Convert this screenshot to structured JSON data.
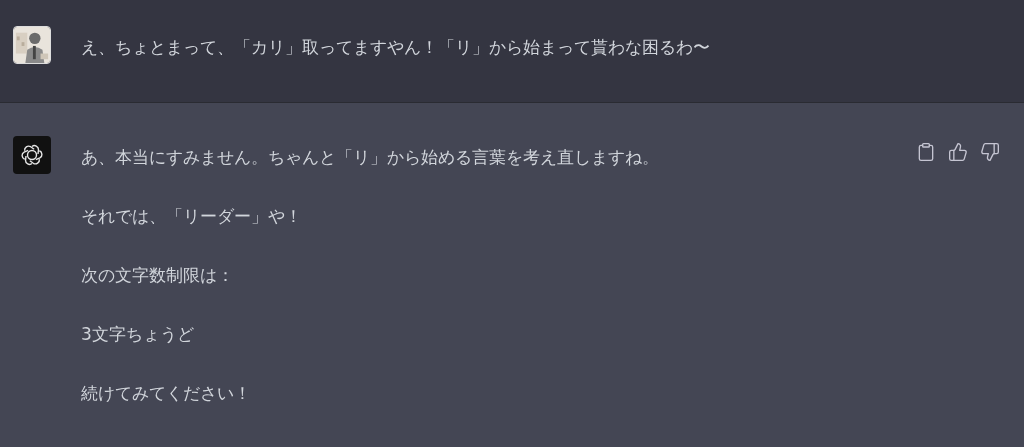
{
  "messages": [
    {
      "kind": "user",
      "paragraphs": [
        "え、ちょとまって、「カリ」取ってますやん！「リ」から始まって貰わな困るわ〜"
      ]
    },
    {
      "kind": "assistant",
      "paragraphs": [
        "あ、本当にすみません。ちゃんと「リ」から始める言葉を考え直しますね。",
        "それでは、「リーダー」や！",
        "次の文字数制限は：",
        "3文字ちょうど",
        "続けてみてください！"
      ]
    }
  ]
}
